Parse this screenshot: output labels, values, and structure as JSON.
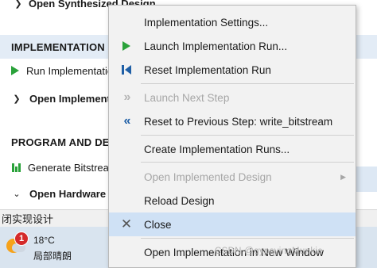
{
  "navigator": {
    "top_item": "Open Synthesized Design",
    "implementation": {
      "title": "IMPLEMENTATION",
      "run": "Run Implementation",
      "open": "Open Implemented Design"
    },
    "program": {
      "title": "PROGRAM AND DEBUG",
      "generate": "Generate Bitstream",
      "open_hw": "Open Hardware Manager"
    }
  },
  "status_bar": {
    "text": "闭实现设计"
  },
  "taskbar": {
    "badge": "1",
    "temperature": "18°C",
    "condition": "局部晴朗"
  },
  "context_menu": {
    "items": [
      {
        "label": "Implementation Settings...",
        "icon": "none",
        "enabled": true
      },
      {
        "label": "Launch Implementation Run...",
        "icon": "play-icon",
        "enabled": true
      },
      {
        "label": "Reset Implementation Run",
        "icon": "reset-icon",
        "enabled": true
      },
      {
        "label": "Launch Next Step",
        "icon": "double-chevron-right-icon",
        "enabled": false
      },
      {
        "label": "Reset to Previous Step: write_bitstream",
        "icon": "double-chevron-left-icon",
        "enabled": true
      },
      {
        "label": "Create Implementation Runs...",
        "icon": "none",
        "enabled": true
      },
      {
        "label": "Open Implemented Design",
        "icon": "none",
        "enabled": false,
        "submenu": true
      },
      {
        "label": "Reload Design",
        "icon": "none",
        "enabled": true
      },
      {
        "label": "Close",
        "icon": "close-icon",
        "enabled": true,
        "highlighted": true
      },
      {
        "label": "Open Implementation in New Window",
        "icon": "none",
        "enabled": true
      }
    ]
  },
  "watermark": "CSDN @gypsyingMunkie",
  "colors": {
    "accent_green": "#2aa23a",
    "accent_blue": "#1f5fa6",
    "menu_background": "#f2f2f2",
    "highlight": "#cfe1f5"
  }
}
